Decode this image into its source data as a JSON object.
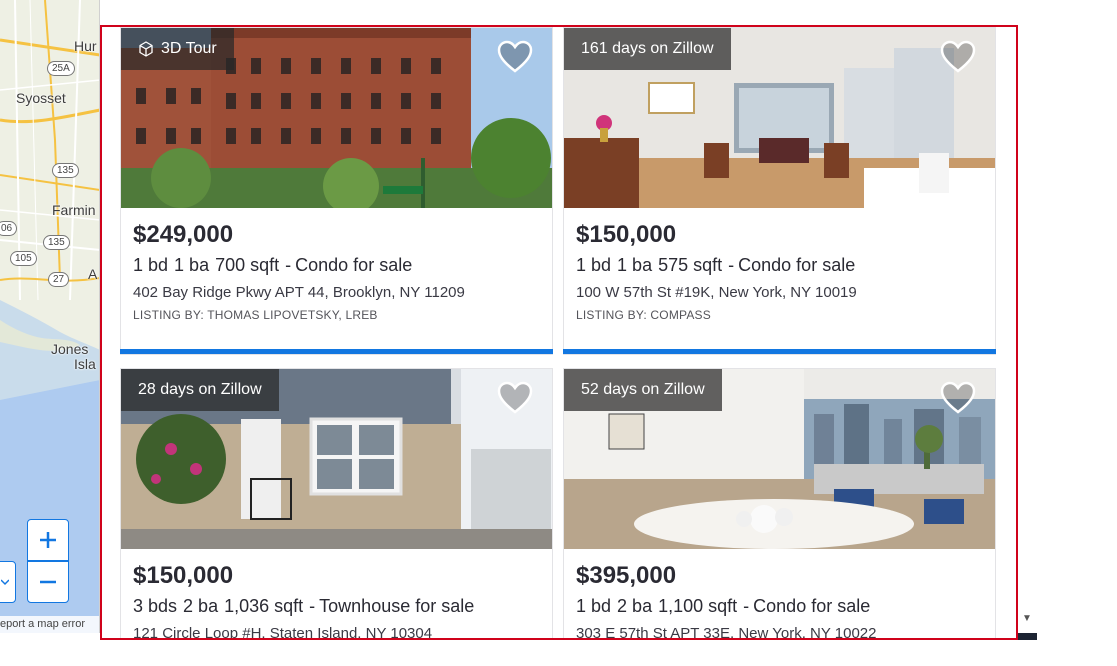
{
  "map": {
    "labels": [
      "Hur",
      "Syosset",
      "Farmin",
      "Jones",
      "Isla",
      "A"
    ],
    "shields": [
      "25A",
      "135",
      "135",
      "06",
      "105",
      "27"
    ],
    "zoom_in_label": "+",
    "zoom_out_label": "−",
    "error_link": "eport a map error",
    "colors": {
      "land": "#eef0e4",
      "water": "#aecbf0",
      "road": "#f5c242"
    }
  },
  "listings": [
    {
      "badge": "3D Tour",
      "badge_icon": "cube-icon",
      "price": "$249,000",
      "beds": "1 bd",
      "baths": "1 ba",
      "sqft": "700 sqft",
      "type": "Condo for sale",
      "address": "402 Bay Ridge Pkwy APT 44, Brooklyn, NY 11209",
      "broker": "LISTING BY: THOMAS LIPOVETSKY, LREB"
    },
    {
      "badge": "161 days on Zillow",
      "price": "$150,000",
      "beds": "1 bd",
      "baths": "1 ba",
      "sqft": "575 sqft",
      "type": "Condo for sale",
      "address": "100 W 57th St #19K, New York, NY 10019",
      "broker": "LISTING BY: COMPASS"
    },
    {
      "badge": "28 days on Zillow",
      "price": "$150,000",
      "beds": "3 bds",
      "baths": "2 ba",
      "sqft": "1,036 sqft",
      "type": "Townhouse for sale",
      "address": "121 Circle Loop #H, Staten Island, NY 10304",
      "broker": ""
    },
    {
      "badge": "52 days on Zillow",
      "price": "$395,000",
      "beds": "1 bd",
      "baths": "2 ba",
      "sqft": "1,100 sqft",
      "type": "Condo for sale",
      "address": "303 E 57th St APT 33E, New York, NY 10022",
      "broker": ""
    }
  ],
  "ui": {
    "dash": "-",
    "accent": "#1277e1",
    "highlight_border": "#d0021b"
  }
}
